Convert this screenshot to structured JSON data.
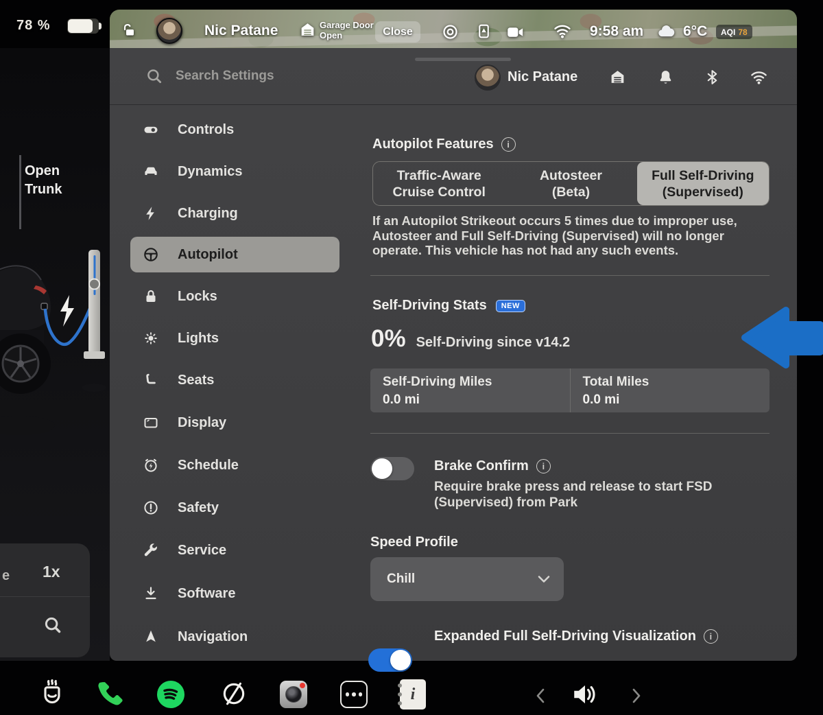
{
  "status_bar": {
    "battery_percent": "78 %"
  },
  "top_bar": {
    "driver_name": "Nic Patane",
    "garage_line1": "Garage Door",
    "garage_line2": "Open",
    "close_label": "Close",
    "time": "9:58 am",
    "temperature": "6°C",
    "aqi_label": "AQI",
    "aqi_value": "78",
    "icons": [
      "unlocked-icon",
      "avatar",
      "garage-home-icon",
      "record-icon",
      "summon-icon",
      "dashcam-icon",
      "wifi-icon",
      "cloud-icon"
    ]
  },
  "settings_header": {
    "search_placeholder": "Search Settings",
    "profile_name": "Nic Patane",
    "icons": [
      "search-icon",
      "avatar",
      "garage-icon",
      "bell-icon",
      "bluetooth-icon",
      "wifi-icon"
    ]
  },
  "sidebar": {
    "items": [
      {
        "label": "Controls",
        "icon": "toggle-icon",
        "selected": false
      },
      {
        "label": "Dynamics",
        "icon": "car-icon",
        "selected": false
      },
      {
        "label": "Charging",
        "icon": "bolt-icon",
        "selected": false
      },
      {
        "label": "Autopilot",
        "icon": "steering-wheel-icon",
        "selected": true
      },
      {
        "label": "Locks",
        "icon": "lock-icon",
        "selected": false
      },
      {
        "label": "Lights",
        "icon": "light-icon",
        "selected": false
      },
      {
        "label": "Seats",
        "icon": "seat-icon",
        "selected": false
      },
      {
        "label": "Display",
        "icon": "display-icon",
        "selected": false
      },
      {
        "label": "Schedule",
        "icon": "schedule-icon",
        "selected": false
      },
      {
        "label": "Safety",
        "icon": "safety-icon",
        "selected": false
      },
      {
        "label": "Service",
        "icon": "wrench-icon",
        "selected": false
      },
      {
        "label": "Software",
        "icon": "download-icon",
        "selected": false
      },
      {
        "label": "Navigation",
        "icon": "navigation-icon",
        "selected": false
      }
    ]
  },
  "autopilot": {
    "features_title": "Autopilot Features",
    "tabs": [
      {
        "line1": "Traffic-Aware",
        "line2": "Cruise Control",
        "selected": false
      },
      {
        "line1": "Autosteer",
        "line2": "(Beta)",
        "selected": false
      },
      {
        "line1": "Full Self-Driving",
        "line2": "(Supervised)",
        "selected": true
      }
    ],
    "warning": "If an Autopilot Strikeout occurs 5 times due to improper use, Autosteer and Full Self-Driving (Supervised) will no longer operate. This vehicle has not had any such events.",
    "stats": {
      "title": "Self-Driving Stats",
      "badge": "NEW",
      "percent": "0%",
      "caption": "Self-Driving since v14.2",
      "cards": [
        {
          "label": "Self-Driving Miles",
          "value": "0.0 mi"
        },
        {
          "label": "Total Miles",
          "value": "0.0 mi"
        }
      ]
    },
    "brake_confirm": {
      "label": "Brake Confirm",
      "description": "Require brake press and release to start FSD (Supervised) from Park",
      "enabled": false
    },
    "speed_profile": {
      "label": "Speed Profile",
      "value": "Chill"
    },
    "expanded_viz": {
      "label": "Expanded Full Self-Driving Visualization",
      "enabled": true
    }
  },
  "left_panel": {
    "open_trunk_line1": "Open",
    "open_trunk_line2": "Trunk",
    "partial_label": "e",
    "playback_speed": "1x"
  },
  "dock": {
    "icons": [
      "hot-drink-icon",
      "phone-icon",
      "spotify-icon",
      "browser-icon",
      "camera-icon",
      "more-apps-icon",
      "owners-manual-icon"
    ],
    "nav": [
      "chevron-left-icon",
      "volume-icon",
      "chevron-right-icon"
    ]
  },
  "colors": {
    "accent_blue": "#2370d8",
    "badge_blue": "#2b6fd9",
    "arrow_blue": "#1b6ec6",
    "spotify_green": "#1ed760",
    "phone_green": "#32d158",
    "aqi_yellow": "#e9a43c",
    "panel_gray": "#3e3e40"
  }
}
